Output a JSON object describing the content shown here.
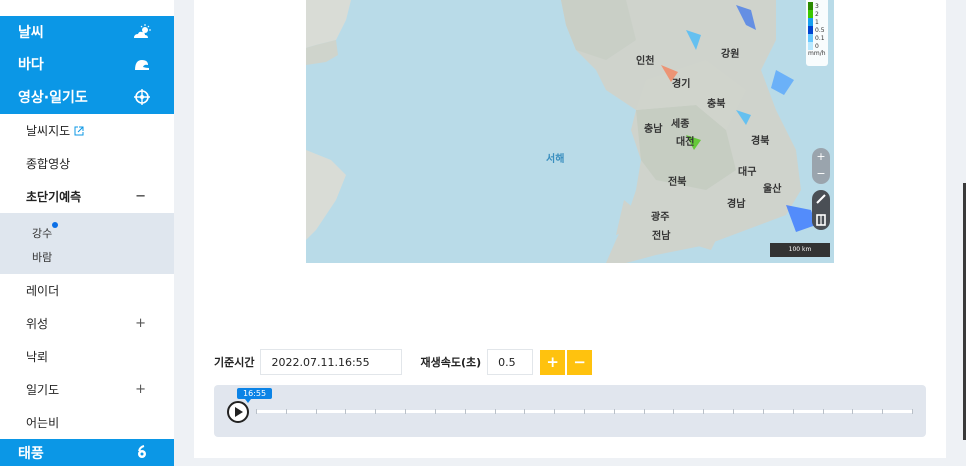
{
  "sidebar": {
    "categories": [
      {
        "label": "날씨",
        "icon": "weather-sun-cloud-icon"
      },
      {
        "label": "바다",
        "icon": "wave-icon"
      },
      {
        "label": "영상·일기도",
        "icon": "satellite-icon"
      },
      {
        "label": "태풍",
        "icon": "typhoon-icon"
      }
    ],
    "items": [
      {
        "label": "날씨지도",
        "icon": "external-link-icon"
      },
      {
        "label": "종합영상"
      },
      {
        "label": "초단기예측",
        "toggle": "−"
      },
      {
        "label": "레이더"
      },
      {
        "label": "위성",
        "toggle": "+"
      },
      {
        "label": "낙뢰"
      },
      {
        "label": "일기도",
        "toggle": "+"
      },
      {
        "label": "어는비"
      }
    ],
    "subitems": [
      {
        "label": "강수"
      },
      {
        "label": "바람"
      }
    ]
  },
  "map": {
    "labels": {
      "incheon": "인천",
      "gyeonggi": "경기",
      "gangwon": "강원",
      "chungbuk": "충북",
      "chungnam": "충남",
      "sejong": "세종",
      "daejeon": "대전",
      "gyeongbuk": "경북",
      "daegu": "대구",
      "jeonbuk": "전북",
      "ulsan": "울산",
      "gyeongnam": "경남",
      "gwangju": "광주",
      "jeonnam": "전남",
      "west_sea": "서해"
    },
    "legend": {
      "values": [
        "3",
        "2",
        "1",
        "0.5",
        "0.1",
        "0"
      ],
      "unit": "mm/h",
      "colors": [
        "#2a8a00",
        "#3cc800",
        "#18a0f0",
        "#0044d0",
        "#66c8ff",
        "#b8e8ff"
      ]
    },
    "scale_label": "100 km",
    "controls": {
      "zoom_in": "+",
      "zoom_out": "−"
    }
  },
  "controls": {
    "base_time_label": "기준시간",
    "base_time_value": "2022.07.11.16:55",
    "speed_label": "재생속도(초)",
    "speed_value": "0.5",
    "plus": "+",
    "minus": "−"
  },
  "timeline": {
    "current_time": "16:55"
  },
  "colors": {
    "accent_blue": "#0b97e6",
    "highlight_yellow": "#ffd400",
    "button_yellow": "#ffc20e"
  }
}
